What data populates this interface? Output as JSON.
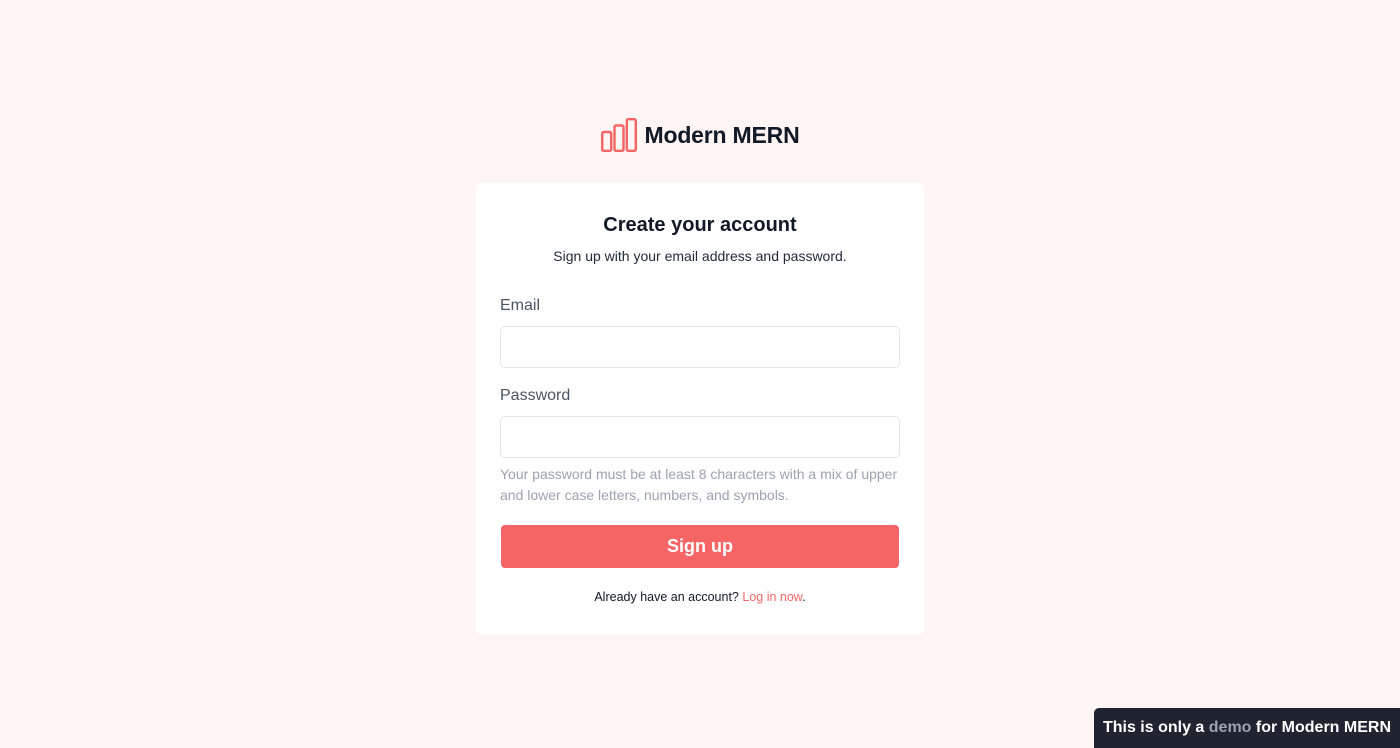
{
  "brand": {
    "name": "Modern MERN",
    "icon": "bar-chart-icon",
    "color": "#f56565"
  },
  "card": {
    "title": "Create your account",
    "subtitle": "Sign up with your email address and password.",
    "email": {
      "label": "Email",
      "value": "",
      "placeholder": ""
    },
    "password": {
      "label": "Password",
      "value": "",
      "placeholder": "",
      "hint": "Your password must be at least 8 characters with a mix of upper and lower case letters, numbers, and symbols."
    },
    "submit_label": "Sign up",
    "login_prompt": "Already have an account?",
    "login_link": "Log in now",
    "login_suffix": "."
  },
  "demo_banner": {
    "prefix": "This is only a",
    "highlight": "demo",
    "suffix": "for Modern MERN"
  },
  "colors": {
    "background": "#fff5f4",
    "accent": "#f56565",
    "banner_bg": "#1f2430"
  }
}
